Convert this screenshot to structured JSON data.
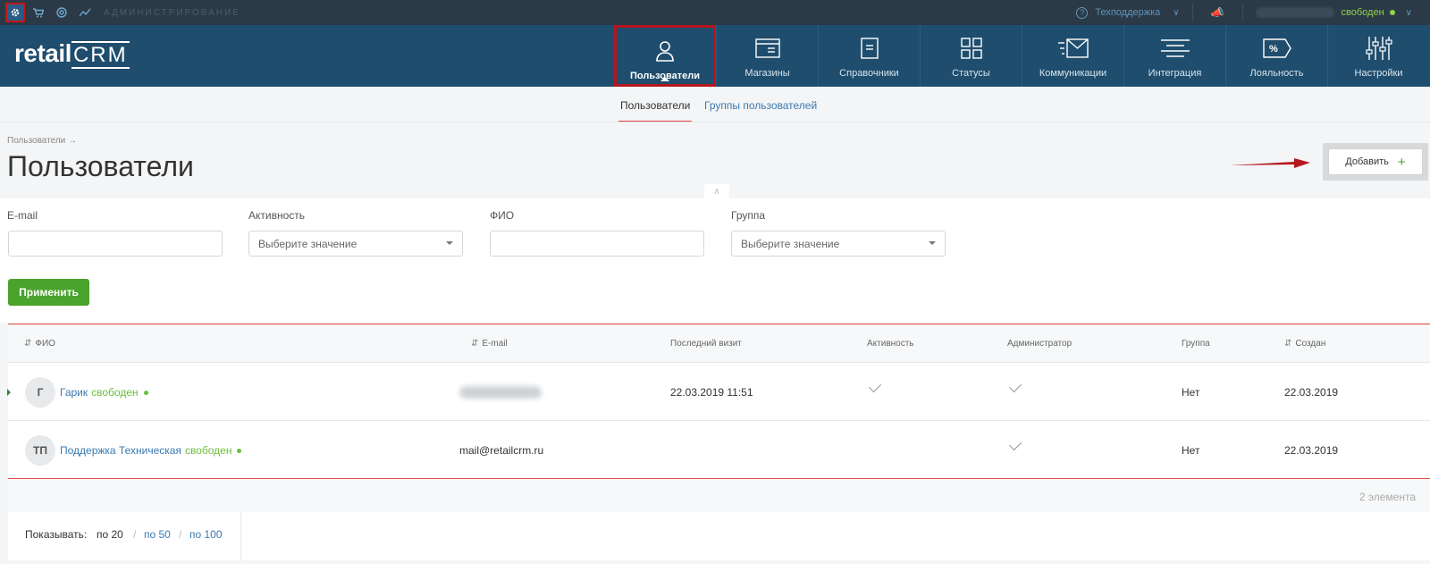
{
  "topbar": {
    "section_label": "АДМИНИСТРИРОВАНИЕ",
    "support_label": "Техподдержка",
    "user_status": "свободен"
  },
  "nav": {
    "items": [
      {
        "label": "Пользователи",
        "icon": "user-icon"
      },
      {
        "label": "Магазины",
        "icon": "store-icon"
      },
      {
        "label": "Справочники",
        "icon": "reference-icon"
      },
      {
        "label": "Статусы",
        "icon": "status-icon"
      },
      {
        "label": "Коммуникации",
        "icon": "communications-icon"
      },
      {
        "label": "Интеграция",
        "icon": "integration-icon"
      },
      {
        "label": "Лояльность",
        "icon": "loyalty-icon"
      },
      {
        "label": "Настройки",
        "icon": "settings-icon"
      }
    ]
  },
  "brand": {
    "name_part1": "retail",
    "name_part2": "CRM"
  },
  "subnav": {
    "active": "Пользователи",
    "other": "Группы пользователей"
  },
  "page": {
    "breadcrumb": "Пользователи →",
    "title": "Пользователи",
    "add_label": "Добавить"
  },
  "filters": {
    "email_label": "E-mail",
    "activity_label": "Активность",
    "activity_value": "Выберите значение",
    "fio_label": "ФИО",
    "group_label": "Группа",
    "group_value": "Выберите значение",
    "apply_label": "Применить"
  },
  "table": {
    "headers": [
      "ФИО",
      "E-mail",
      "Последний визит",
      "Активность",
      "Администратор",
      "Группа",
      "Создан"
    ],
    "rows": [
      {
        "initials": "Г",
        "name": "Гарик",
        "status": "свободен",
        "email": "",
        "last_visit": "22.03.2019 11:51",
        "active": true,
        "admin": true,
        "group": "Нет",
        "created": "22.03.2019"
      },
      {
        "initials": "ТП",
        "name": "Поддержка Техническая",
        "status": "свободен",
        "email": "mail@retailcrm.ru",
        "last_visit": "",
        "active": false,
        "admin": true,
        "group": "Нет",
        "created": "22.03.2019"
      }
    ],
    "count_label": "2 элемента"
  },
  "pager": {
    "show_label": "Показывать:",
    "options": [
      "по 20",
      "по 50",
      "по 100"
    ],
    "separator": "/"
  }
}
